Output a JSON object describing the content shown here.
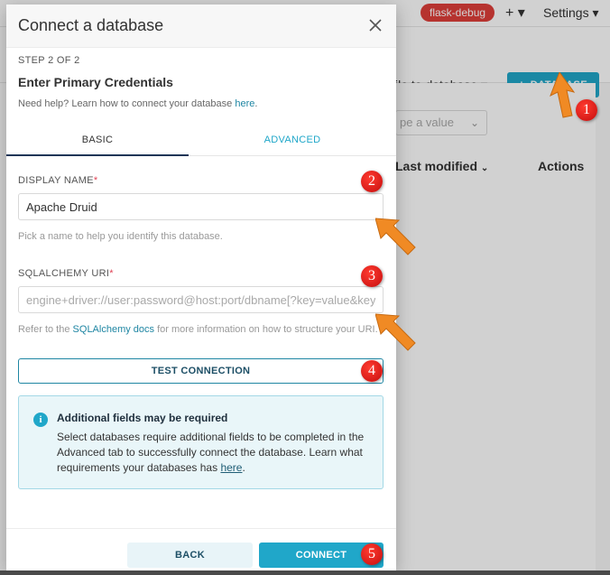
{
  "background": {
    "env_badge": "flask-debug",
    "plus_menu": "+ ▾",
    "settings_menu": "Settings ▾",
    "link_to_database": "ile to database ▾",
    "database_button": "DATABASE",
    "filter_placeholder": "pe a value",
    "col_last_modified": "Last modified",
    "col_actions": "Actions"
  },
  "modal": {
    "title": "Connect a database",
    "step_label": "STEP 2 OF 2",
    "step_title": "Enter Primary Credentials",
    "help_prefix": "Need help? Learn how to connect your database ",
    "help_link": "here",
    "help_suffix": ".",
    "tabs": [
      {
        "label": "BASIC",
        "active": true
      },
      {
        "label": "ADVANCED",
        "active": false
      }
    ],
    "display_name": {
      "label": "DISPLAY NAME",
      "required_mark": "*",
      "value": "Apache Druid",
      "hint": "Pick a name to help you identify this database."
    },
    "sqlalchemy_uri": {
      "label": "SQLALCHEMY URI",
      "required_mark": "*",
      "placeholder": "engine+driver://user:password@host:port/dbname[?key=value&key=value...]",
      "refer_prefix": "Refer to the ",
      "refer_link": "SQLAlchemy docs",
      "refer_suffix": " for more information on how to structure your URI."
    },
    "test_connection_label": "TEST CONNECTION",
    "info": {
      "title": "Additional fields may be required",
      "body": "Select databases require additional fields to be completed in the Advanced tab to successfully connect the database. Learn what requirements your databases has ",
      "link": "here",
      "suffix": "."
    },
    "back_label": "BACK",
    "connect_label": "CONNECT"
  },
  "markers": [
    "1",
    "2",
    "3",
    "4",
    "5"
  ],
  "colors": {
    "accent": "#20a7c9",
    "marker_red": "#e0201a",
    "arrow_orange": "#f08a24"
  }
}
